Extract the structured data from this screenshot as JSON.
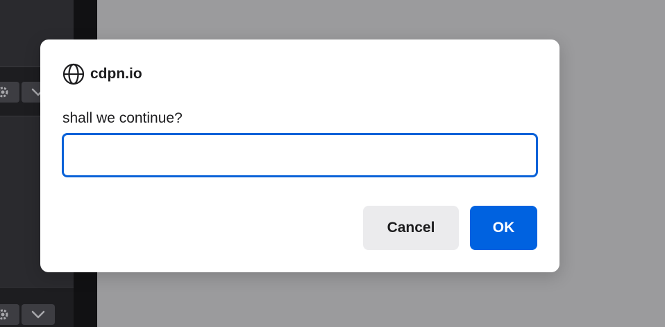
{
  "dialog": {
    "origin": "cdpn.io",
    "origin_icon": "globe-icon",
    "message": "shall we continue?",
    "input": {
      "value": "",
      "placeholder": ""
    },
    "cancel_label": "Cancel",
    "ok_label": "OK"
  },
  "background": {
    "toolbar_icons": [
      "gear-icon",
      "chevron-down-icon"
    ]
  },
  "colors": {
    "accent": "#0062e0",
    "focus_ring": "#0a62d8",
    "overlay": "#9b9b9d",
    "dialog_bg": "#ffffff",
    "cancel_bg": "#ebebed"
  }
}
